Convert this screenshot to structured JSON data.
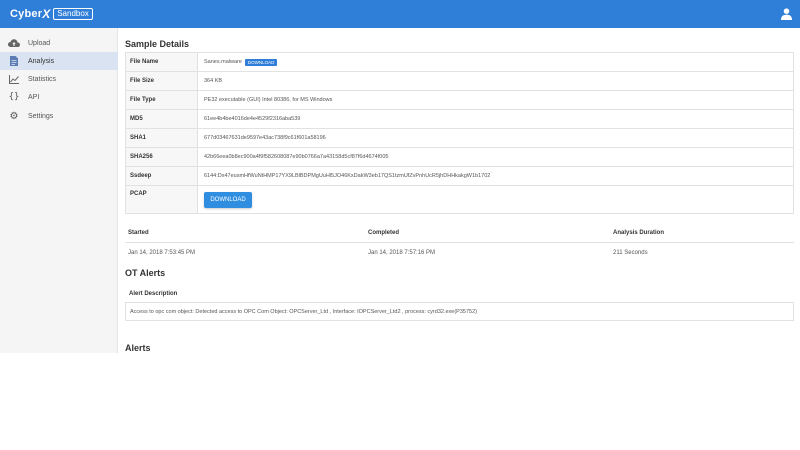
{
  "header": {
    "brand_name": "Cyber",
    "brand_x": "X",
    "brand_badge": "Sandbox",
    "user_icon": "user-icon",
    "bar_color": "#2f7ed8"
  },
  "sidebar": {
    "items": [
      {
        "label": "Upload",
        "icon": "cloud-upload-icon"
      },
      {
        "label": "Analysis",
        "icon": "document-icon",
        "active": true
      },
      {
        "label": "Statistics",
        "icon": "line-chart-icon"
      },
      {
        "label": "API",
        "icon": "braces-icon"
      },
      {
        "label": "Settings",
        "icon": "gear-icon"
      }
    ]
  },
  "sample_details": {
    "title": "Sample Details",
    "rows": [
      {
        "key": "File Name",
        "value": "Sanes.malware",
        "badge": "DOWNLOAD"
      },
      {
        "key": "File Size",
        "value": "364 KB"
      },
      {
        "key": "File Type",
        "value": "PE32 executable (GUI) Intel 80386, for MS Windows"
      },
      {
        "key": "MD5",
        "value": "61ee4b4be4016de4e4529f2316aba539"
      },
      {
        "key": "SHA1",
        "value": "677d03467631de9597e43ac738f9c61f601a58196"
      },
      {
        "key": "SHA256",
        "value": "42b66eea0b8ec900a4f9f582608087e90b0766a7a43158d5cf87f6d4674f005"
      },
      {
        "key": "Ssdeep",
        "value": "6144:Dx47eusmHfWuNtHMP17YX9LBlBDPMgUuHl5JO46KxDakW3eb17QS1tzmUfZvPnhUcR5jhDHHkakgW1b1702"
      },
      {
        "key": "PCAP",
        "button": "DOWNLOAD"
      }
    ]
  },
  "timing": {
    "headers": [
      "Started",
      "Completed",
      "Analysis Duration"
    ],
    "values": [
      "Jan 14, 2018 7:53:45 PM",
      "Jan 14, 2018 7:57:16 PM",
      "211 Seconds"
    ]
  },
  "ot_alerts": {
    "title": "OT Alerts",
    "column": "Alert Description",
    "rows": [
      "Access to opc com object: Detected access to OPC Com Object: OPCServer_Ltd , Interface: IOPCServer_Ltd2 , process: cyrd32.exe(P35752)"
    ]
  },
  "alerts": {
    "title": "Alerts"
  }
}
